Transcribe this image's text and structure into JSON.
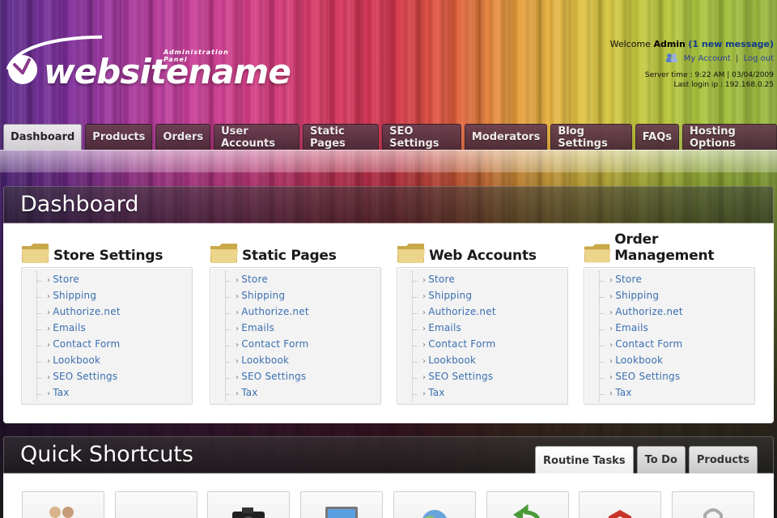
{
  "brand": {
    "site_name": "websitename",
    "panel_label": "Administration Panel"
  },
  "user": {
    "welcome_prefix": "Welcome",
    "username": "Admin",
    "message_text": "(1 new message)",
    "my_account": "My Account",
    "separator": "|",
    "logout": "Log out",
    "server_time": "Server time : 9:22 AM | 03/04/2009",
    "last_login": "Last login ip : 192.168.0.25"
  },
  "nav": {
    "tabs": [
      {
        "label": "Dashboard",
        "active": true
      },
      {
        "label": "Products"
      },
      {
        "label": "Orders"
      },
      {
        "label": "User Accounts"
      },
      {
        "label": "Static Pages"
      },
      {
        "label": "SEO Settings"
      },
      {
        "label": "Moderators"
      },
      {
        "label": "Blog Settings"
      },
      {
        "label": "FAQs"
      },
      {
        "label": "Hosting Options"
      }
    ]
  },
  "dashboard": {
    "title": "Dashboard",
    "columns": [
      {
        "title": "Store Settings",
        "icon": "folder-icon",
        "links": [
          "Store",
          "Shipping",
          "Authorize.net",
          "Emails",
          "Contact Form",
          "Lookbook",
          "SEO Settings",
          "Tax"
        ]
      },
      {
        "title": "Static Pages",
        "icon": "folder-icon",
        "links": [
          "Store",
          "Shipping",
          "Authorize.net",
          "Emails",
          "Contact Form",
          "Lookbook",
          "SEO Settings",
          "Tax"
        ]
      },
      {
        "title": "Web Accounts",
        "icon": "folder-icon",
        "links": [
          "Store",
          "Shipping",
          "Authorize.net",
          "Emails",
          "Contact Form",
          "Lookbook",
          "SEO Settings",
          "Tax"
        ]
      },
      {
        "title": "Order Management",
        "icon": "folder-icon",
        "links": [
          "Store",
          "Shipping",
          "Authorize.net",
          "Emails",
          "Contact Form",
          "Lookbook",
          "SEO Settings",
          "Tax"
        ]
      }
    ],
    "link_arrow": "›"
  },
  "quick": {
    "title": "Quick Shortcuts",
    "tabs": [
      {
        "label": "Routine Tasks",
        "active": true
      },
      {
        "label": "To Do"
      },
      {
        "label": "Products"
      }
    ],
    "shortcuts": [
      {
        "icon": "users-icon"
      },
      {
        "icon": "folder-icon"
      },
      {
        "icon": "camera-icon"
      },
      {
        "icon": "monitor-icon"
      },
      {
        "icon": "globe-icon"
      },
      {
        "icon": "refresh-arrow-icon"
      },
      {
        "icon": "hexagon-icon"
      },
      {
        "icon": "lock-icon"
      }
    ]
  },
  "colors": {
    "link": "#3b6fb0",
    "folder": "#e7cf7a"
  }
}
